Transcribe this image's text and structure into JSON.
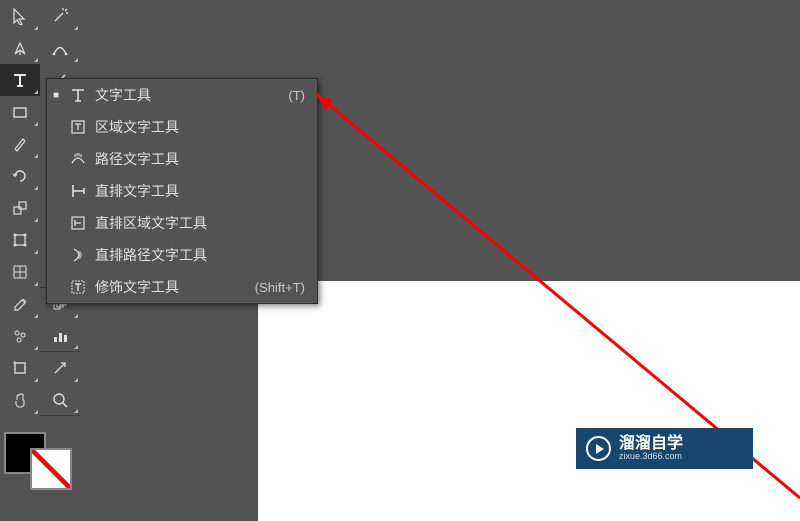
{
  "flyout": {
    "items": [
      {
        "label": "文字工具",
        "shortcut": "(T)",
        "selected": true,
        "icon": "type"
      },
      {
        "label": "区域文字工具",
        "shortcut": "",
        "selected": false,
        "icon": "area-type"
      },
      {
        "label": "路径文字工具",
        "shortcut": "",
        "selected": false,
        "icon": "path-type"
      },
      {
        "label": "直排文字工具",
        "shortcut": "",
        "selected": false,
        "icon": "vtype"
      },
      {
        "label": "直排区域文字工具",
        "shortcut": "",
        "selected": false,
        "icon": "varea-type"
      },
      {
        "label": "直排路径文字工具",
        "shortcut": "",
        "selected": false,
        "icon": "vpath-type"
      },
      {
        "label": "修饰文字工具",
        "shortcut": "(Shift+T)",
        "selected": false,
        "icon": "touch-type"
      }
    ]
  },
  "watermark": {
    "title": "溜溜自学",
    "url": "zixue.3d66.com"
  },
  "colors": {
    "accent": "#17466f",
    "arrow": "#ff0000"
  }
}
